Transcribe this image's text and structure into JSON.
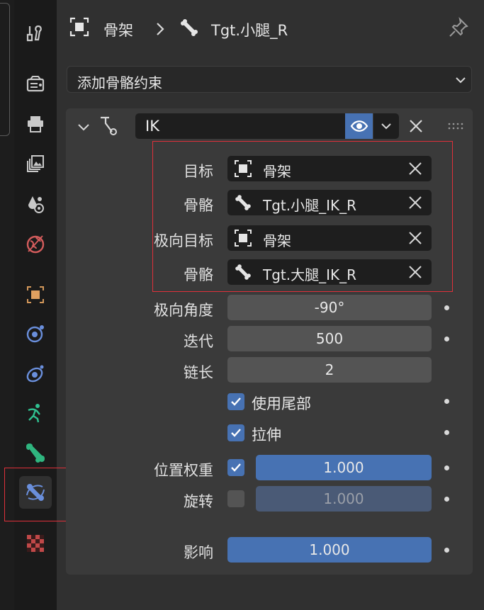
{
  "breadcrumb": {
    "object": "骨架",
    "bone": "Tgt.小腿_R"
  },
  "add_constraint": {
    "label": "添加骨骼约束"
  },
  "constraint": {
    "name": "IK",
    "target": {
      "label": "目标",
      "value": "骨架"
    },
    "bone": {
      "label": "骨骼",
      "value": "Tgt.小腿_IK_R"
    },
    "pole_target": {
      "label": "极向目标",
      "value": "骨架"
    },
    "pole_bone": {
      "label": "骨骼",
      "value": "Tgt.大腿_IK_R"
    },
    "pole_angle": {
      "label": "极向角度",
      "value": "-90°"
    },
    "iterations": {
      "label": "迭代",
      "value": "500"
    },
    "chain_length": {
      "label": "链长",
      "value": "2"
    },
    "use_tail": {
      "label": "使用尾部",
      "checked": true
    },
    "stretch": {
      "label": "拉伸",
      "checked": true
    },
    "weight_position": {
      "label": "位置权重",
      "value": "1.000",
      "checked": true
    },
    "rotation": {
      "label": "旋转",
      "value": "1.000",
      "checked": false
    },
    "influence": {
      "label": "影响",
      "value": "1.000"
    }
  },
  "colors": {
    "accent": "#4772b3",
    "highlight_box": "#e0303a"
  },
  "tabs": [
    "tool-icon",
    "render-icon",
    "output-icon",
    "view-layer-icon",
    "scene-icon",
    "world-icon",
    "object-icon",
    "modifier-icon",
    "particles-icon",
    "physics-icon",
    "bone-icon",
    "bone-constraint-icon",
    "texture-icon"
  ]
}
